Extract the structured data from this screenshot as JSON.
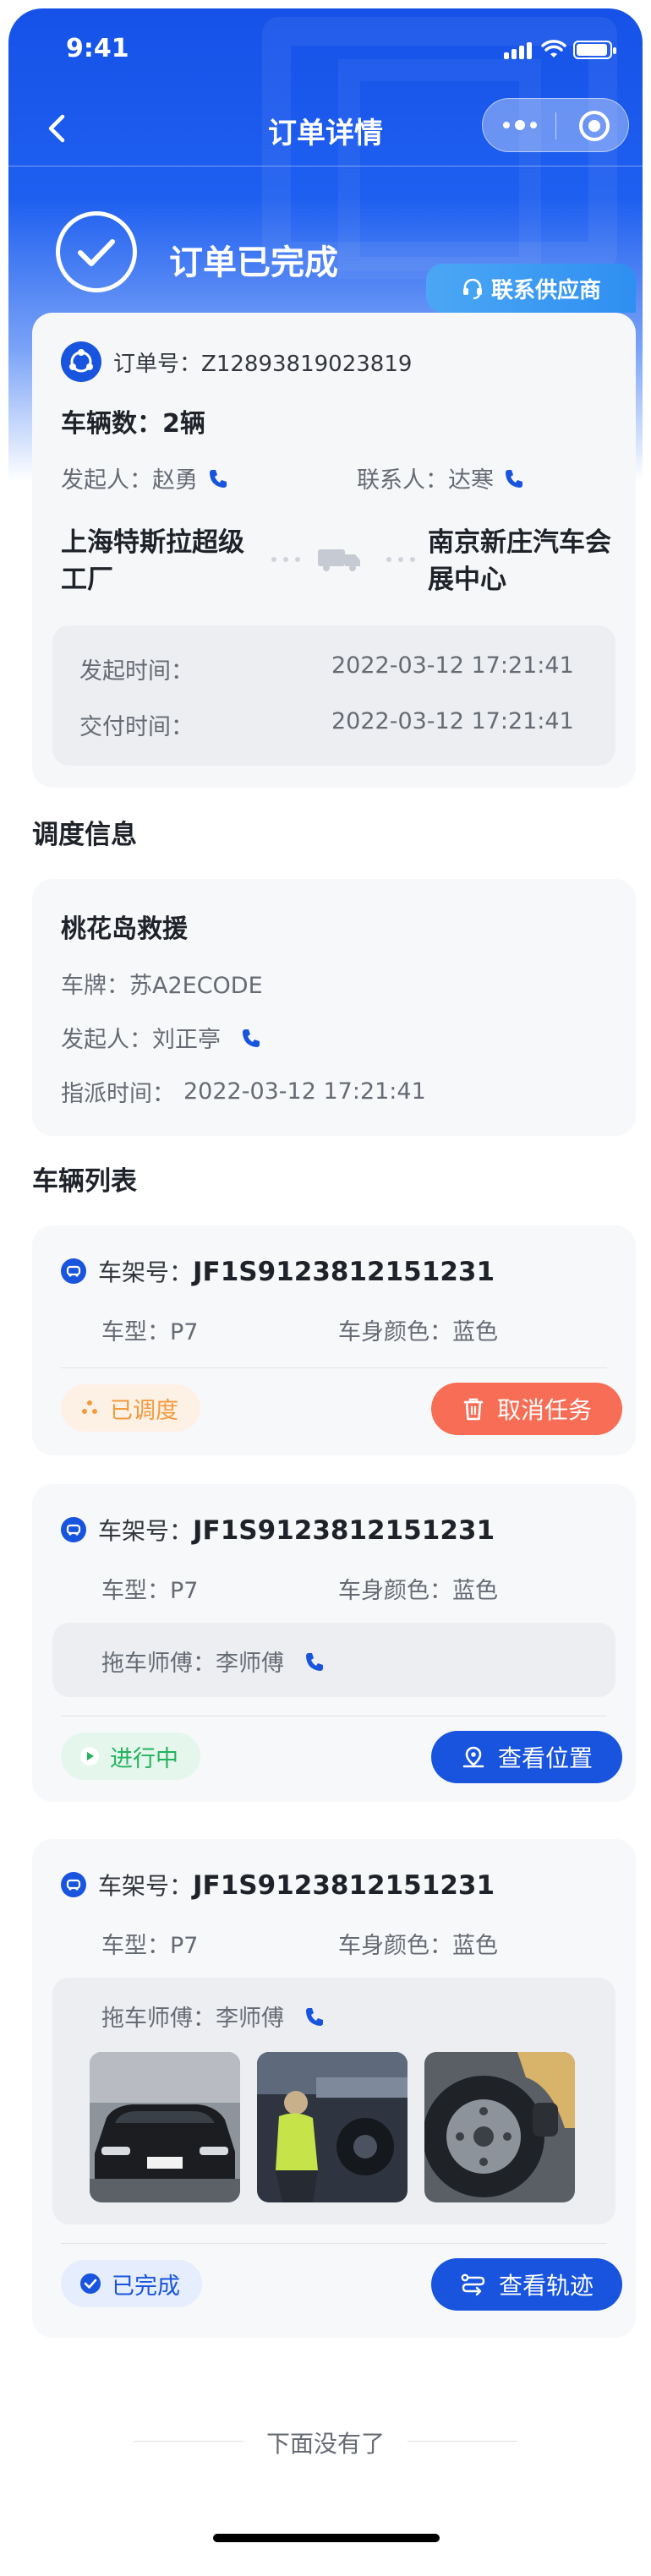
{
  "status_bar": {
    "time": "9:41"
  },
  "nav": {
    "title": "订单详情"
  },
  "order_status": {
    "text": "订单已完成"
  },
  "supplier_button": {
    "label": "联系供应商"
  },
  "order": {
    "number_label": "订单号：",
    "number": "Z12893819023819",
    "vehicle_count": "车辆数：2辆",
    "initiator_label": "发起人：",
    "initiator": "赵勇",
    "contact_label": "联系人：",
    "contact": "达寒",
    "from": "上海特斯拉超级工厂",
    "to": "南京新庄汽车会展中心",
    "start_label": "发起时间：",
    "start_time": "2022-03-12   17:21:41",
    "delivery_label": "交付时间：",
    "delivery_time": "2022-03-12   17:21:41"
  },
  "dispatch": {
    "section_title": "调度信息",
    "name": "桃花岛救援",
    "plate_label": "车牌：",
    "plate": "苏A2ECODE",
    "initiator_label": "发起人：",
    "initiator": "刘正亭",
    "time_label": "指派时间：",
    "time": "2022-03-12   17:21:41"
  },
  "vehicles": {
    "section_title": "车辆列表",
    "items": [
      {
        "vin_label": "车架号：",
        "vin": "JF1S9123812151231",
        "model_label": "车型：",
        "model": "P7",
        "color_label": "车身颜色：",
        "color": "蓝色",
        "status": "已调度",
        "action": "取消任务"
      },
      {
        "vin_label": "车架号：",
        "vin": "JF1S9123812151231",
        "model_label": "车型：",
        "model": "P7",
        "color_label": "车身颜色：",
        "color": "蓝色",
        "driver_label": "拖车师傅：",
        "driver": "李师傅",
        "status": "进行中",
        "action": "查看位置"
      },
      {
        "vin_label": "车架号：",
        "vin": "JF1S9123812151231",
        "model_label": "车型：",
        "model": "P7",
        "color_label": "车身颜色：",
        "color": "蓝色",
        "driver_label": "拖车师傅：",
        "driver": "李师傅",
        "status": "已完成",
        "action": "查看轨迹"
      }
    ]
  },
  "footer": {
    "end_text": "下面没有了"
  },
  "colors": {
    "primary": "#1854de",
    "cancel": "#f86d55",
    "dispatched": "#f39a3c",
    "in_progress": "#22b35e",
    "done": "#1854de"
  }
}
